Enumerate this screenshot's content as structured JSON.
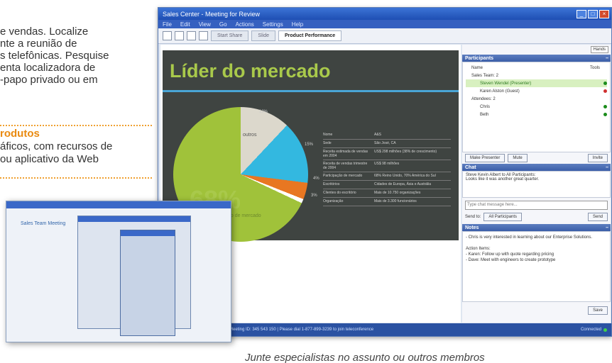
{
  "brochure": {
    "lines": [
      "e vendas. Localize",
      "nte a reunião de",
      "s telefônicas. Pesquise",
      "enta localizadora de",
      "-papo privado ou em"
    ],
    "subhead": "rodutos",
    "sub_lines": [
      "áficos, com recursos de",
      "ou aplicativo da Web"
    ],
    "caption": "Junte especialistas no assunto ou outros membros"
  },
  "window": {
    "title": "Sales Center - Meeting for Review",
    "menu": [
      "File",
      "Edit",
      "View",
      "Go",
      "Actions",
      "Settings",
      "Help"
    ],
    "tabs": [
      "Start Share",
      "Slide",
      "Product Performance"
    ]
  },
  "slide": {
    "title": "Líder do mercado",
    "big_pct": "68%",
    "big_label": "participação de mercado",
    "outros_label": "outros",
    "pct_12": "12%",
    "pct_15": "15%",
    "pct_4": "4%",
    "pct_3": "3%",
    "stats": [
      {
        "k": "Nome",
        "v": "A&S"
      },
      {
        "k": "Sede",
        "v": "São José, CA"
      },
      {
        "k": "Receita estimada de vendas em 2004",
        "v": "US$ 298 milhões (38% de crescimento)"
      },
      {
        "k": "Receita de vendas trimestre de 2004",
        "v": "US$ 98 milhões"
      },
      {
        "k": "Participação de mercado",
        "v": "68% Reino Unido, 70% América do Sul"
      },
      {
        "k": "Escritórios",
        "v": "Cidades de Europa, Ásia e Austrália"
      },
      {
        "k": "Clientes do escritório",
        "v": "Mais de 10.750 organizações"
      },
      {
        "k": "Organização",
        "v": "Mais de 3.300 funcionários"
      }
    ]
  },
  "right_panel": {
    "view_select": "Hands",
    "participants_title": "Participants",
    "col_name": "Name",
    "col_tools": "Tools",
    "participants": [
      {
        "name": "Sales Team: 2",
        "indent": 1,
        "hl": false
      },
      {
        "name": "Steven Wendel (Presenter)",
        "indent": 2,
        "hl": true,
        "dot": "#1b8c1b"
      },
      {
        "name": "Karen Alston (Guest)",
        "indent": 2,
        "hl": false,
        "dot": "#d03030"
      },
      {
        "name": "Attendees: 2",
        "indent": 1,
        "hl": false
      },
      {
        "name": "Chris",
        "indent": 2,
        "hl": false,
        "dot": "#1b8c1b"
      },
      {
        "name": "Beth",
        "indent": 2,
        "hl": false,
        "dot": "#1b8c1b"
      }
    ],
    "make_presenter": "Make Presenter",
    "mute": "Mute",
    "invite": "Invite",
    "chat_title": "Chat",
    "chat_from": "Steve Kevin Albert to All Participants:",
    "chat_msg": "Looks like it was another great quarter.",
    "chat_placeholder": "Type chat message here...",
    "send": "Send",
    "send_to_label": "Send to:",
    "send_to_value": "All Participants",
    "notes_title": "Notes",
    "notes_lines": [
      "- Chris is very interested in learning about our Enterprise Solutions.",
      "",
      "Action Items:",
      "- Karen: Follow up with quote regarding pricing",
      "- Dave: Meet with engineers to create prototype"
    ],
    "save": "Save"
  },
  "status": {
    "text": "Meeting ID: 345 543 150  |  Please dial 1-877-899-3239 to join teleconference",
    "connected": "Connected"
  },
  "inset": {
    "heading": "Sales Team Meeting"
  }
}
